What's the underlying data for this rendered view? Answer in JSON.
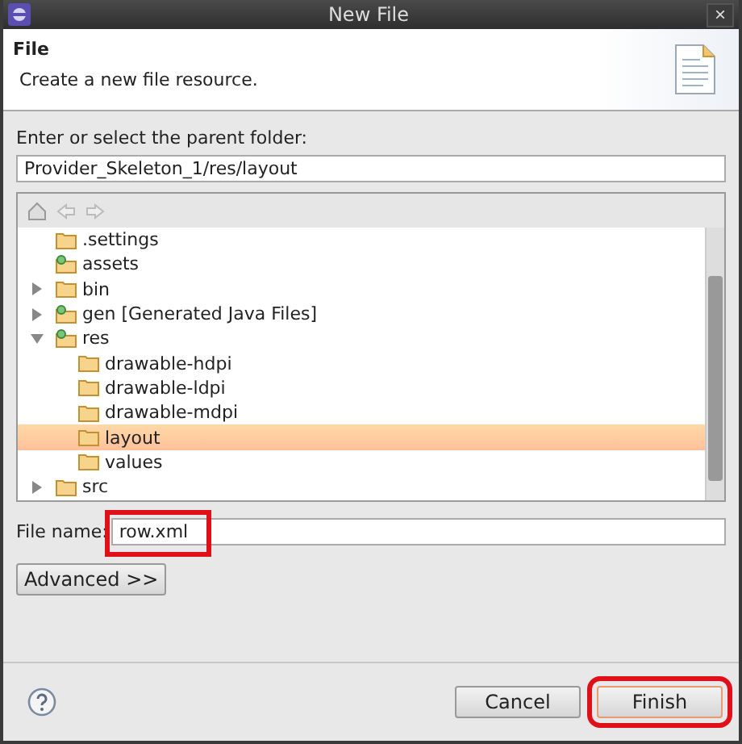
{
  "window": {
    "title": "New File",
    "close": "×"
  },
  "header": {
    "title": "File",
    "description": "Create a new file resource."
  },
  "parent_folder": {
    "label": "Enter or select the parent folder:",
    "value": "Provider_Skeleton_1/res/layout"
  },
  "tree": [
    {
      "label": ".settings",
      "kind": "folder",
      "selected": false
    },
    {
      "label": "assets",
      "kind": "source_folder",
      "selected": false
    },
    {
      "label": "bin",
      "kind": "folder",
      "expanded": false,
      "selected": false
    },
    {
      "label": "gen [Generated Java Files]",
      "kind": "source_folder",
      "expanded": false,
      "selected": false
    },
    {
      "label": "res",
      "kind": "source_folder",
      "expanded": true,
      "selected": false,
      "children": [
        {
          "label": "drawable-hdpi",
          "kind": "folder",
          "selected": false
        },
        {
          "label": "drawable-ldpi",
          "kind": "folder",
          "selected": false
        },
        {
          "label": "drawable-mdpi",
          "kind": "folder",
          "selected": false
        },
        {
          "label": "layout",
          "kind": "folder",
          "selected": true
        },
        {
          "label": "values",
          "kind": "folder",
          "selected": false
        }
      ]
    },
    {
      "label": "src",
      "kind": "folder",
      "expanded": false,
      "selected": false
    }
  ],
  "file_name": {
    "label": "File name:",
    "value": "row.xml",
    "highlighted": true
  },
  "advanced_button": {
    "label": "Advanced >>"
  },
  "buttons": [
    {
      "label": "Cancel",
      "highlighted": false
    },
    {
      "label": "Finish",
      "highlighted": true
    }
  ]
}
